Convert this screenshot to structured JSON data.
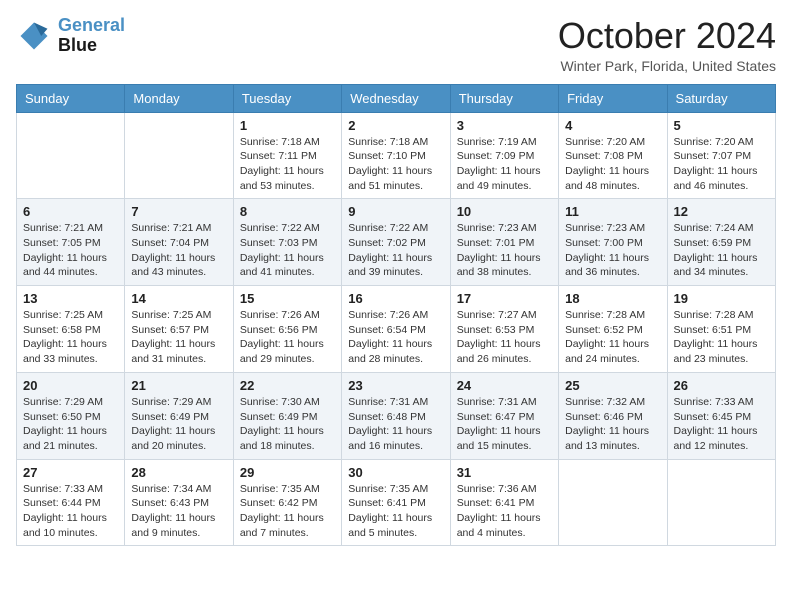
{
  "header": {
    "logo_line1": "General",
    "logo_line2": "Blue",
    "month_title": "October 2024",
    "location": "Winter Park, Florida, United States"
  },
  "weekdays": [
    "Sunday",
    "Monday",
    "Tuesday",
    "Wednesday",
    "Thursday",
    "Friday",
    "Saturday"
  ],
  "weeks": [
    [
      {
        "day": "",
        "info": ""
      },
      {
        "day": "",
        "info": ""
      },
      {
        "day": "1",
        "info": "Sunrise: 7:18 AM\nSunset: 7:11 PM\nDaylight: 11 hours and 53 minutes."
      },
      {
        "day": "2",
        "info": "Sunrise: 7:18 AM\nSunset: 7:10 PM\nDaylight: 11 hours and 51 minutes."
      },
      {
        "day": "3",
        "info": "Sunrise: 7:19 AM\nSunset: 7:09 PM\nDaylight: 11 hours and 49 minutes."
      },
      {
        "day": "4",
        "info": "Sunrise: 7:20 AM\nSunset: 7:08 PM\nDaylight: 11 hours and 48 minutes."
      },
      {
        "day": "5",
        "info": "Sunrise: 7:20 AM\nSunset: 7:07 PM\nDaylight: 11 hours and 46 minutes."
      }
    ],
    [
      {
        "day": "6",
        "info": "Sunrise: 7:21 AM\nSunset: 7:05 PM\nDaylight: 11 hours and 44 minutes."
      },
      {
        "day": "7",
        "info": "Sunrise: 7:21 AM\nSunset: 7:04 PM\nDaylight: 11 hours and 43 minutes."
      },
      {
        "day": "8",
        "info": "Sunrise: 7:22 AM\nSunset: 7:03 PM\nDaylight: 11 hours and 41 minutes."
      },
      {
        "day": "9",
        "info": "Sunrise: 7:22 AM\nSunset: 7:02 PM\nDaylight: 11 hours and 39 minutes."
      },
      {
        "day": "10",
        "info": "Sunrise: 7:23 AM\nSunset: 7:01 PM\nDaylight: 11 hours and 38 minutes."
      },
      {
        "day": "11",
        "info": "Sunrise: 7:23 AM\nSunset: 7:00 PM\nDaylight: 11 hours and 36 minutes."
      },
      {
        "day": "12",
        "info": "Sunrise: 7:24 AM\nSunset: 6:59 PM\nDaylight: 11 hours and 34 minutes."
      }
    ],
    [
      {
        "day": "13",
        "info": "Sunrise: 7:25 AM\nSunset: 6:58 PM\nDaylight: 11 hours and 33 minutes."
      },
      {
        "day": "14",
        "info": "Sunrise: 7:25 AM\nSunset: 6:57 PM\nDaylight: 11 hours and 31 minutes."
      },
      {
        "day": "15",
        "info": "Sunrise: 7:26 AM\nSunset: 6:56 PM\nDaylight: 11 hours and 29 minutes."
      },
      {
        "day": "16",
        "info": "Sunrise: 7:26 AM\nSunset: 6:54 PM\nDaylight: 11 hours and 28 minutes."
      },
      {
        "day": "17",
        "info": "Sunrise: 7:27 AM\nSunset: 6:53 PM\nDaylight: 11 hours and 26 minutes."
      },
      {
        "day": "18",
        "info": "Sunrise: 7:28 AM\nSunset: 6:52 PM\nDaylight: 11 hours and 24 minutes."
      },
      {
        "day": "19",
        "info": "Sunrise: 7:28 AM\nSunset: 6:51 PM\nDaylight: 11 hours and 23 minutes."
      }
    ],
    [
      {
        "day": "20",
        "info": "Sunrise: 7:29 AM\nSunset: 6:50 PM\nDaylight: 11 hours and 21 minutes."
      },
      {
        "day": "21",
        "info": "Sunrise: 7:29 AM\nSunset: 6:49 PM\nDaylight: 11 hours and 20 minutes."
      },
      {
        "day": "22",
        "info": "Sunrise: 7:30 AM\nSunset: 6:49 PM\nDaylight: 11 hours and 18 minutes."
      },
      {
        "day": "23",
        "info": "Sunrise: 7:31 AM\nSunset: 6:48 PM\nDaylight: 11 hours and 16 minutes."
      },
      {
        "day": "24",
        "info": "Sunrise: 7:31 AM\nSunset: 6:47 PM\nDaylight: 11 hours and 15 minutes."
      },
      {
        "day": "25",
        "info": "Sunrise: 7:32 AM\nSunset: 6:46 PM\nDaylight: 11 hours and 13 minutes."
      },
      {
        "day": "26",
        "info": "Sunrise: 7:33 AM\nSunset: 6:45 PM\nDaylight: 11 hours and 12 minutes."
      }
    ],
    [
      {
        "day": "27",
        "info": "Sunrise: 7:33 AM\nSunset: 6:44 PM\nDaylight: 11 hours and 10 minutes."
      },
      {
        "day": "28",
        "info": "Sunrise: 7:34 AM\nSunset: 6:43 PM\nDaylight: 11 hours and 9 minutes."
      },
      {
        "day": "29",
        "info": "Sunrise: 7:35 AM\nSunset: 6:42 PM\nDaylight: 11 hours and 7 minutes."
      },
      {
        "day": "30",
        "info": "Sunrise: 7:35 AM\nSunset: 6:41 PM\nDaylight: 11 hours and 5 minutes."
      },
      {
        "day": "31",
        "info": "Sunrise: 7:36 AM\nSunset: 6:41 PM\nDaylight: 11 hours and 4 minutes."
      },
      {
        "day": "",
        "info": ""
      },
      {
        "day": "",
        "info": ""
      }
    ]
  ]
}
